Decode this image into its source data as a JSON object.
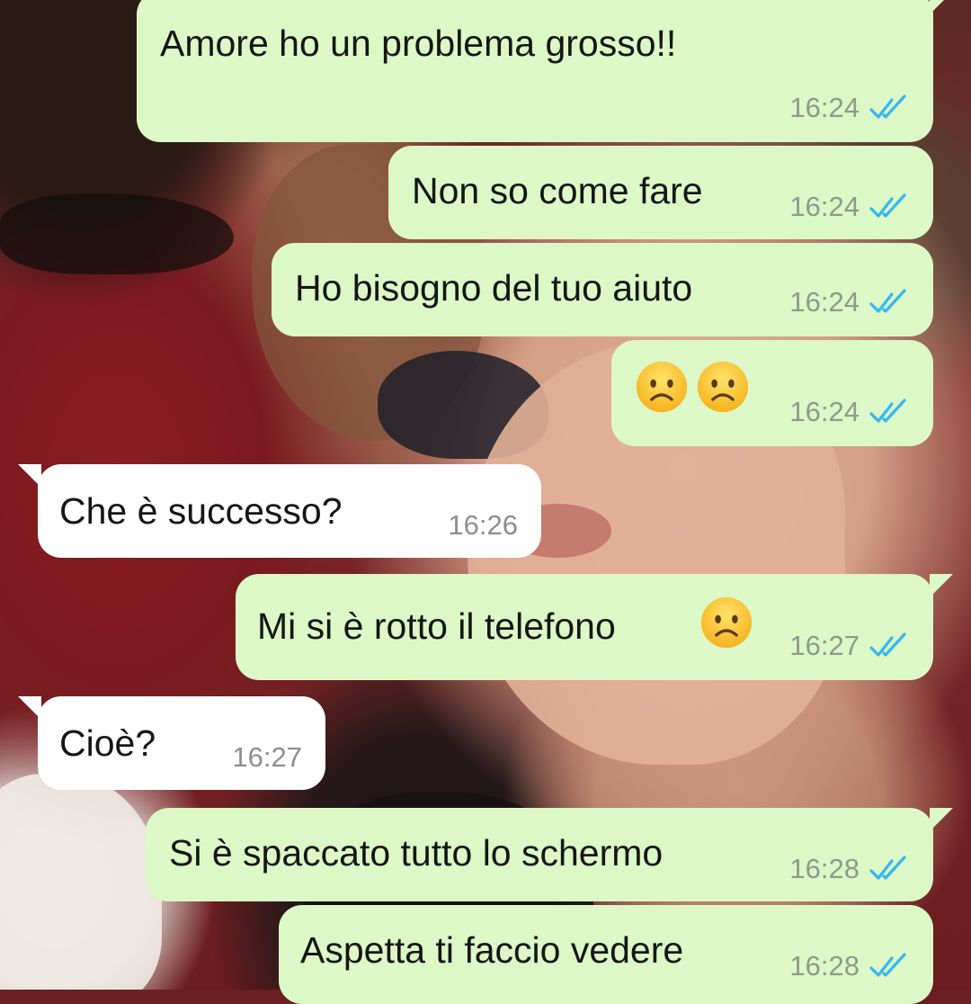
{
  "colors": {
    "outgoing_bubble": "#dcf8c6",
    "incoming_bubble": "#ffffff",
    "read_ticks": "#34b7f1",
    "timestamp": "#8e9a8b"
  },
  "icons": {
    "read_status": "double-check-icon",
    "frown_emoji": "frowning-face-emoji"
  },
  "messages": [
    {
      "direction": "out",
      "text": "Amore ho un problema grosso!!",
      "time": "16:24",
      "status": "read"
    },
    {
      "direction": "out",
      "text": "Non so come fare",
      "time": "16:24",
      "status": "read"
    },
    {
      "direction": "out",
      "text": "Ho bisogno del tuo aiuto",
      "time": "16:24",
      "status": "read"
    },
    {
      "direction": "out",
      "text": "",
      "emoji": [
        "☹️",
        "☹️"
      ],
      "time": "16:24",
      "status": "read"
    },
    {
      "direction": "in",
      "text": "Che è successo?",
      "time": "16:26"
    },
    {
      "direction": "out",
      "text": "Mi si è rotto il telefono",
      "emoji": [
        "☹️"
      ],
      "time": "16:27",
      "status": "read"
    },
    {
      "direction": "in",
      "text": "Cioè?",
      "time": "16:27"
    },
    {
      "direction": "out",
      "text": "Si è spaccato tutto lo schermo",
      "time": "16:28",
      "status": "read"
    },
    {
      "direction": "out",
      "text": "Aspetta ti faccio vedere",
      "time": "16:28",
      "status": "read"
    }
  ]
}
